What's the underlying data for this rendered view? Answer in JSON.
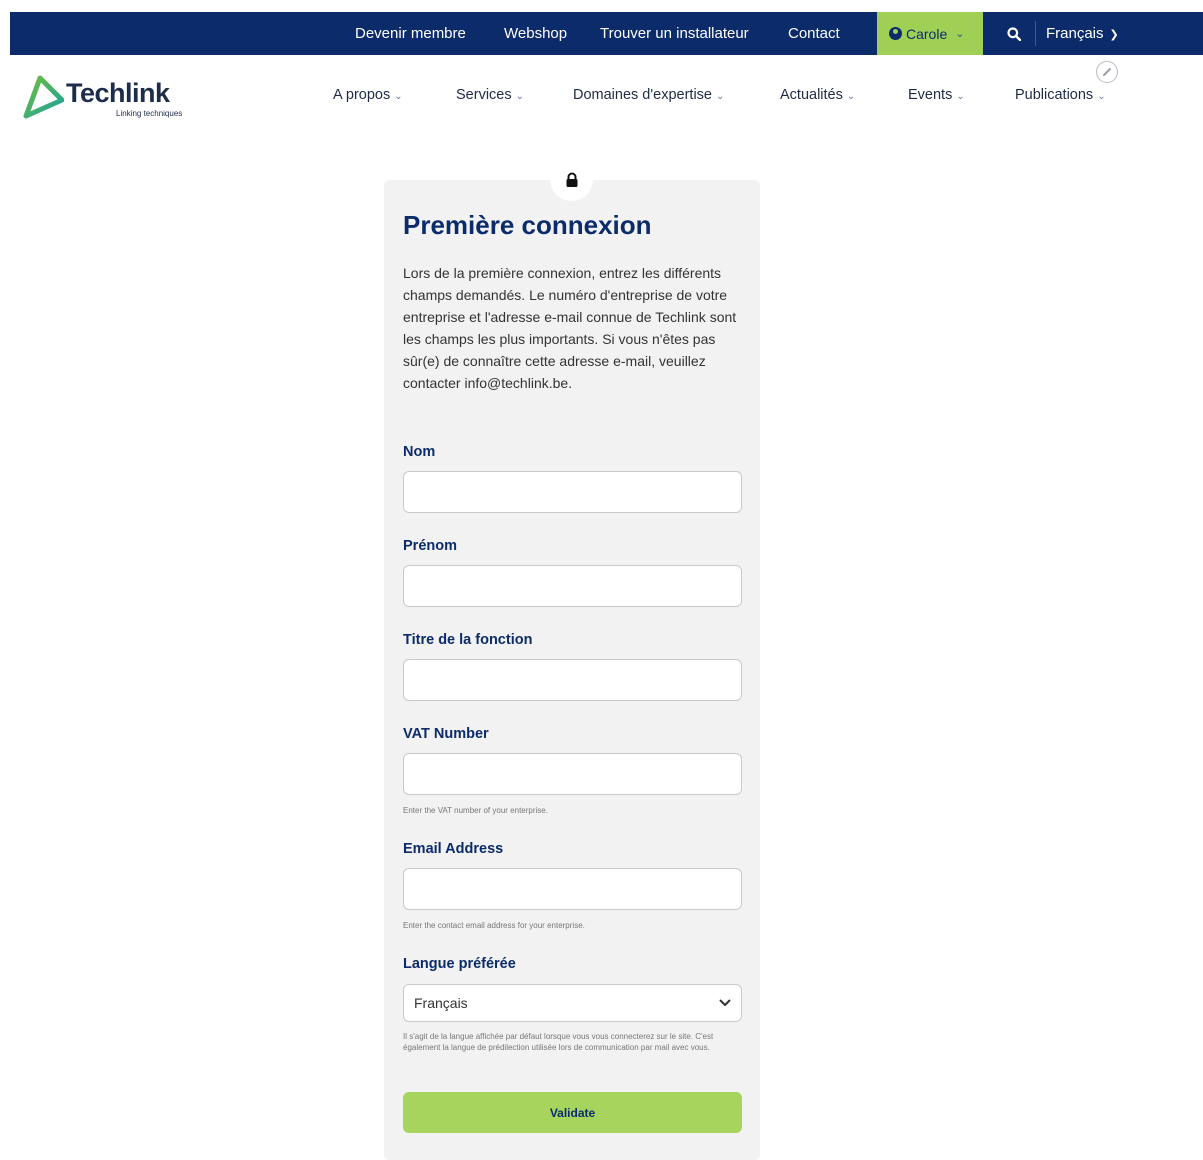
{
  "topbar": {
    "links": [
      "Devenir membre",
      "Webshop",
      "Trouver un installateur",
      "Contact"
    ],
    "user_name": "Carole",
    "language": "Français",
    "colors": {
      "background": "#0b2b6b",
      "user_bg": "#9fd055"
    }
  },
  "logo": {
    "brand": "Techlink",
    "tagline": "Linking techniques"
  },
  "nav": {
    "items": [
      "A propos",
      "Services",
      "Domaines d'expertise",
      "Actualités",
      "Events",
      "Publications"
    ]
  },
  "form": {
    "lock_icon": "lock-icon",
    "title": "Première connexion",
    "intro": "Lors de la première connexion, entrez les différents champs demandés. Le numéro d'entreprise de votre entreprise et l'adresse e-mail connue de Techlink sont les champs les plus importants. Si vous n'êtes pas sûr(e) de connaître cette adresse e-mail, veuillez contacter info@techlink.be.",
    "fields": {
      "nom": {
        "label": "Nom",
        "value": ""
      },
      "prenom": {
        "label": "Prénom",
        "value": ""
      },
      "titre": {
        "label": "Titre de la fonction",
        "value": ""
      },
      "vat": {
        "label": "VAT Number",
        "value": "",
        "help": "Enter the VAT number of your enterprise."
      },
      "email": {
        "label": "Email Address",
        "value": "",
        "help": "Enter the contact email address for your enterprise."
      },
      "langue": {
        "label": "Langue préférée",
        "selected": "Français",
        "help": "Il s'agit de la langue affichée par défaut lorsque vous vous connecterez sur le site. C'est également la langue de prédilection utilisée lors de communication par mail avec vous."
      }
    },
    "submit_label": "Validate",
    "colors": {
      "title": "#0b2b6b",
      "button": "#a6d45c"
    }
  }
}
